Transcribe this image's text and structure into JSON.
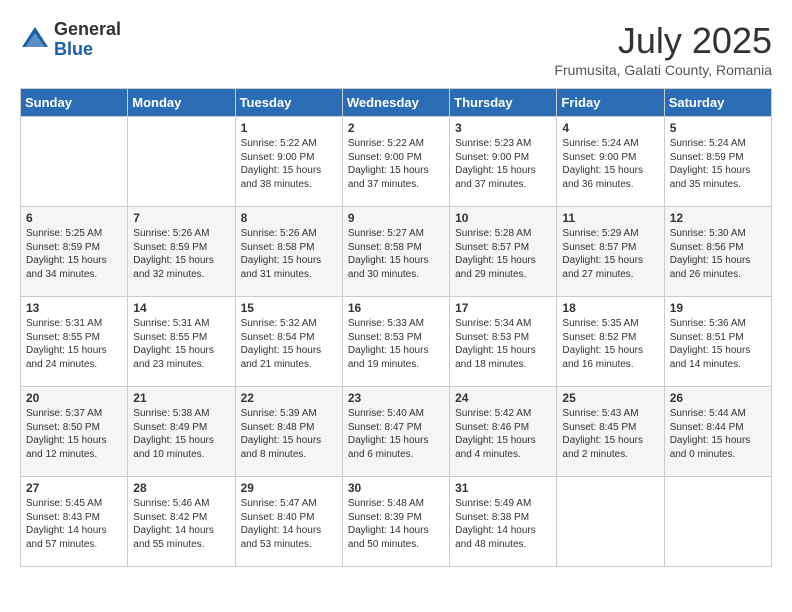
{
  "header": {
    "logo_general": "General",
    "logo_blue": "Blue",
    "month_year": "July 2025",
    "location": "Frumusita, Galati County, Romania"
  },
  "calendar": {
    "days_of_week": [
      "Sunday",
      "Monday",
      "Tuesday",
      "Wednesday",
      "Thursday",
      "Friday",
      "Saturday"
    ],
    "weeks": [
      [
        {
          "day": "",
          "info": ""
        },
        {
          "day": "",
          "info": ""
        },
        {
          "day": "1",
          "info": "Sunrise: 5:22 AM\nSunset: 9:00 PM\nDaylight: 15 hours\nand 38 minutes."
        },
        {
          "day": "2",
          "info": "Sunrise: 5:22 AM\nSunset: 9:00 PM\nDaylight: 15 hours\nand 37 minutes."
        },
        {
          "day": "3",
          "info": "Sunrise: 5:23 AM\nSunset: 9:00 PM\nDaylight: 15 hours\nand 37 minutes."
        },
        {
          "day": "4",
          "info": "Sunrise: 5:24 AM\nSunset: 9:00 PM\nDaylight: 15 hours\nand 36 minutes."
        },
        {
          "day": "5",
          "info": "Sunrise: 5:24 AM\nSunset: 8:59 PM\nDaylight: 15 hours\nand 35 minutes."
        }
      ],
      [
        {
          "day": "6",
          "info": "Sunrise: 5:25 AM\nSunset: 8:59 PM\nDaylight: 15 hours\nand 34 minutes."
        },
        {
          "day": "7",
          "info": "Sunrise: 5:26 AM\nSunset: 8:59 PM\nDaylight: 15 hours\nand 32 minutes."
        },
        {
          "day": "8",
          "info": "Sunrise: 5:26 AM\nSunset: 8:58 PM\nDaylight: 15 hours\nand 31 minutes."
        },
        {
          "day": "9",
          "info": "Sunrise: 5:27 AM\nSunset: 8:58 PM\nDaylight: 15 hours\nand 30 minutes."
        },
        {
          "day": "10",
          "info": "Sunrise: 5:28 AM\nSunset: 8:57 PM\nDaylight: 15 hours\nand 29 minutes."
        },
        {
          "day": "11",
          "info": "Sunrise: 5:29 AM\nSunset: 8:57 PM\nDaylight: 15 hours\nand 27 minutes."
        },
        {
          "day": "12",
          "info": "Sunrise: 5:30 AM\nSunset: 8:56 PM\nDaylight: 15 hours\nand 26 minutes."
        }
      ],
      [
        {
          "day": "13",
          "info": "Sunrise: 5:31 AM\nSunset: 8:55 PM\nDaylight: 15 hours\nand 24 minutes."
        },
        {
          "day": "14",
          "info": "Sunrise: 5:31 AM\nSunset: 8:55 PM\nDaylight: 15 hours\nand 23 minutes."
        },
        {
          "day": "15",
          "info": "Sunrise: 5:32 AM\nSunset: 8:54 PM\nDaylight: 15 hours\nand 21 minutes."
        },
        {
          "day": "16",
          "info": "Sunrise: 5:33 AM\nSunset: 8:53 PM\nDaylight: 15 hours\nand 19 minutes."
        },
        {
          "day": "17",
          "info": "Sunrise: 5:34 AM\nSunset: 8:53 PM\nDaylight: 15 hours\nand 18 minutes."
        },
        {
          "day": "18",
          "info": "Sunrise: 5:35 AM\nSunset: 8:52 PM\nDaylight: 15 hours\nand 16 minutes."
        },
        {
          "day": "19",
          "info": "Sunrise: 5:36 AM\nSunset: 8:51 PM\nDaylight: 15 hours\nand 14 minutes."
        }
      ],
      [
        {
          "day": "20",
          "info": "Sunrise: 5:37 AM\nSunset: 8:50 PM\nDaylight: 15 hours\nand 12 minutes."
        },
        {
          "day": "21",
          "info": "Sunrise: 5:38 AM\nSunset: 8:49 PM\nDaylight: 15 hours\nand 10 minutes."
        },
        {
          "day": "22",
          "info": "Sunrise: 5:39 AM\nSunset: 8:48 PM\nDaylight: 15 hours\nand 8 minutes."
        },
        {
          "day": "23",
          "info": "Sunrise: 5:40 AM\nSunset: 8:47 PM\nDaylight: 15 hours\nand 6 minutes."
        },
        {
          "day": "24",
          "info": "Sunrise: 5:42 AM\nSunset: 8:46 PM\nDaylight: 15 hours\nand 4 minutes."
        },
        {
          "day": "25",
          "info": "Sunrise: 5:43 AM\nSunset: 8:45 PM\nDaylight: 15 hours\nand 2 minutes."
        },
        {
          "day": "26",
          "info": "Sunrise: 5:44 AM\nSunset: 8:44 PM\nDaylight: 15 hours\nand 0 minutes."
        }
      ],
      [
        {
          "day": "27",
          "info": "Sunrise: 5:45 AM\nSunset: 8:43 PM\nDaylight: 14 hours\nand 57 minutes."
        },
        {
          "day": "28",
          "info": "Sunrise: 5:46 AM\nSunset: 8:42 PM\nDaylight: 14 hours\nand 55 minutes."
        },
        {
          "day": "29",
          "info": "Sunrise: 5:47 AM\nSunset: 8:40 PM\nDaylight: 14 hours\nand 53 minutes."
        },
        {
          "day": "30",
          "info": "Sunrise: 5:48 AM\nSunset: 8:39 PM\nDaylight: 14 hours\nand 50 minutes."
        },
        {
          "day": "31",
          "info": "Sunrise: 5:49 AM\nSunset: 8:38 PM\nDaylight: 14 hours\nand 48 minutes."
        },
        {
          "day": "",
          "info": ""
        },
        {
          "day": "",
          "info": ""
        }
      ]
    ]
  }
}
